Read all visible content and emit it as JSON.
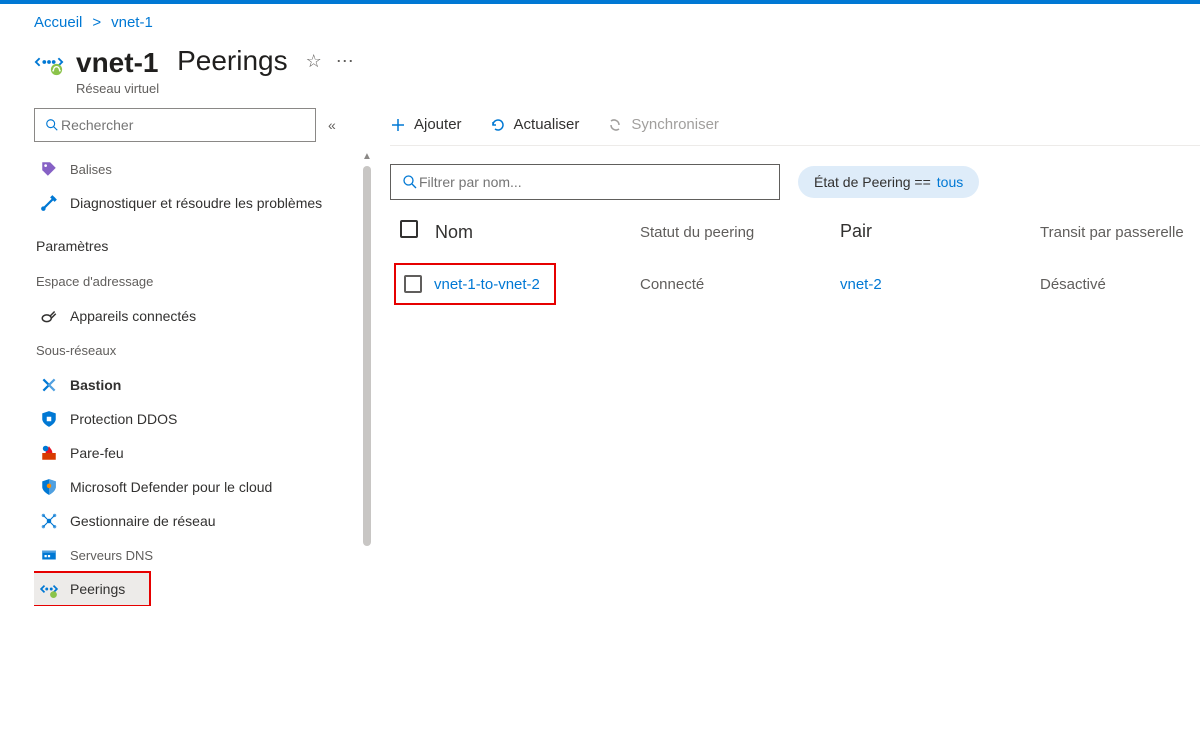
{
  "breadcrumb": {
    "home": "Accueil",
    "resource": "vnet-1"
  },
  "header": {
    "resource_name": "vnet-1",
    "resource_type": "Réseau virtuel",
    "page_title": "Peerings"
  },
  "sidebar": {
    "search_placeholder": "Rechercher",
    "items": [
      {
        "icon": "tag-icon",
        "label": "Balises",
        "kind": "item"
      },
      {
        "icon": "wrench-icon",
        "label": "Diagnostiquer et résoudre les problèmes",
        "kind": "item"
      },
      {
        "label": "Paramètres",
        "kind": "section"
      },
      {
        "label": "Espace d'adressage",
        "kind": "sub"
      },
      {
        "icon": "plug-icon",
        "label": "Appareils connectés",
        "kind": "item"
      },
      {
        "label": "Sous-réseaux",
        "kind": "sub"
      },
      {
        "icon": "bastion-icon",
        "label": "Bastion",
        "kind": "item",
        "bold": true
      },
      {
        "icon": "shield-blue-icon",
        "label": "Protection DDOS",
        "kind": "item"
      },
      {
        "icon": "firewall-icon",
        "label": "Pare-feu",
        "kind": "item"
      },
      {
        "icon": "shield-orange-icon",
        "label": "Microsoft Defender pour le cloud",
        "kind": "item"
      },
      {
        "icon": "network-icon",
        "label": "Gestionnaire de réseau",
        "kind": "item"
      },
      {
        "icon": "dns-icon",
        "label": "Serveurs DNS",
        "kind": "item"
      },
      {
        "icon": "peering-icon",
        "label": "Peerings",
        "kind": "item",
        "selected": true,
        "highlight": true
      }
    ]
  },
  "toolbar": {
    "add": "Ajouter",
    "refresh": "Actualiser",
    "sync": "Synchroniser"
  },
  "filter": {
    "placeholder": "Filtrer par nom...",
    "pill_label": "État de Peering ==",
    "pill_value": "tous"
  },
  "table": {
    "columns": {
      "name": "Nom",
      "status": "Statut du peering",
      "peer": "Pair",
      "transit": "Transit par passerelle"
    },
    "rows": [
      {
        "name": "vnet-1-to-vnet-2",
        "status": "Connecté",
        "peer": "vnet-2",
        "transit": "Désactivé"
      }
    ]
  }
}
